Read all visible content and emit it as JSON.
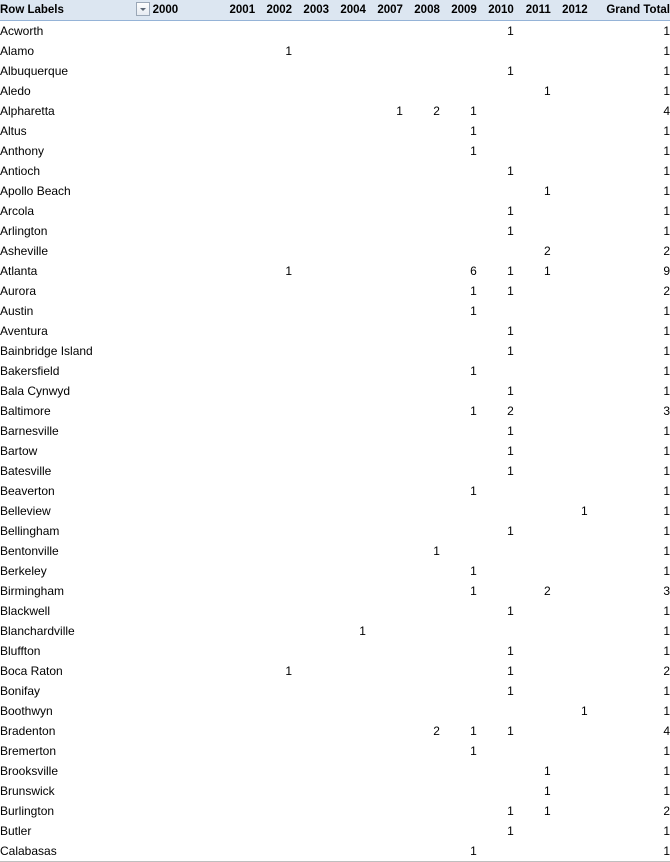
{
  "table": {
    "row_label_header": "Row Labels",
    "filter_icon": "chevron-down-icon",
    "grand_total_header": "Grand Total",
    "header_bg": "#dce6f1",
    "header_border": "#95b3d7",
    "year_columns": [
      "2000",
      "2001",
      "2002",
      "2003",
      "2004",
      "2007",
      "2008",
      "2009",
      "2010",
      "2011",
      "2012"
    ],
    "rows": [
      {
        "label": "Acworth",
        "values": [
          "",
          "",
          "",
          "",
          "",
          "",
          "",
          "",
          "1",
          "",
          ""
        ],
        "total": "1"
      },
      {
        "label": "Alamo",
        "values": [
          "",
          "",
          "1",
          "",
          "",
          "",
          "",
          "",
          "",
          "",
          ""
        ],
        "total": "1"
      },
      {
        "label": "Albuquerque",
        "values": [
          "",
          "",
          "",
          "",
          "",
          "",
          "",
          "",
          "1",
          "",
          ""
        ],
        "total": "1"
      },
      {
        "label": "Aledo",
        "values": [
          "",
          "",
          "",
          "",
          "",
          "",
          "",
          "",
          "",
          "1",
          ""
        ],
        "total": "1"
      },
      {
        "label": "Alpharetta",
        "values": [
          "",
          "",
          "",
          "",
          "",
          "1",
          "2",
          "1",
          "",
          "",
          ""
        ],
        "total": "4"
      },
      {
        "label": "Altus",
        "values": [
          "",
          "",
          "",
          "",
          "",
          "",
          "",
          "1",
          "",
          "",
          ""
        ],
        "total": "1"
      },
      {
        "label": "Anthony",
        "values": [
          "",
          "",
          "",
          "",
          "",
          "",
          "",
          "1",
          "",
          "",
          ""
        ],
        "total": "1"
      },
      {
        "label": "Antioch",
        "values": [
          "",
          "",
          "",
          "",
          "",
          "",
          "",
          "",
          "1",
          "",
          ""
        ],
        "total": "1"
      },
      {
        "label": "Apollo Beach",
        "values": [
          "",
          "",
          "",
          "",
          "",
          "",
          "",
          "",
          "",
          "1",
          ""
        ],
        "total": "1"
      },
      {
        "label": "Arcola",
        "values": [
          "",
          "",
          "",
          "",
          "",
          "",
          "",
          "",
          "1",
          "",
          ""
        ],
        "total": "1"
      },
      {
        "label": "Arlington",
        "values": [
          "",
          "",
          "",
          "",
          "",
          "",
          "",
          "",
          "1",
          "",
          ""
        ],
        "total": "1"
      },
      {
        "label": "Asheville",
        "values": [
          "",
          "",
          "",
          "",
          "",
          "",
          "",
          "",
          "",
          "2",
          ""
        ],
        "total": "2"
      },
      {
        "label": "Atlanta",
        "values": [
          "",
          "",
          "1",
          "",
          "",
          "",
          "",
          "6",
          "1",
          "1",
          ""
        ],
        "total": "9"
      },
      {
        "label": "Aurora",
        "values": [
          "",
          "",
          "",
          "",
          "",
          "",
          "",
          "1",
          "1",
          "",
          ""
        ],
        "total": "2"
      },
      {
        "label": "Austin",
        "values": [
          "",
          "",
          "",
          "",
          "",
          "",
          "",
          "1",
          "",
          "",
          ""
        ],
        "total": "1"
      },
      {
        "label": "Aventura",
        "values": [
          "",
          "",
          "",
          "",
          "",
          "",
          "",
          "",
          "1",
          "",
          ""
        ],
        "total": "1"
      },
      {
        "label": "Bainbridge Island",
        "values": [
          "",
          "",
          "",
          "",
          "",
          "",
          "",
          "",
          "1",
          "",
          ""
        ],
        "total": "1"
      },
      {
        "label": "Bakersfield",
        "values": [
          "",
          "",
          "",
          "",
          "",
          "",
          "",
          "1",
          "",
          "",
          ""
        ],
        "total": "1"
      },
      {
        "label": "Bala Cynwyd",
        "values": [
          "",
          "",
          "",
          "",
          "",
          "",
          "",
          "",
          "1",
          "",
          ""
        ],
        "total": "1"
      },
      {
        "label": "Baltimore",
        "values": [
          "",
          "",
          "",
          "",
          "",
          "",
          "",
          "1",
          "2",
          "",
          ""
        ],
        "total": "3"
      },
      {
        "label": "Barnesville",
        "values": [
          "",
          "",
          "",
          "",
          "",
          "",
          "",
          "",
          "1",
          "",
          ""
        ],
        "total": "1"
      },
      {
        "label": "Bartow",
        "values": [
          "",
          "",
          "",
          "",
          "",
          "",
          "",
          "",
          "1",
          "",
          ""
        ],
        "total": "1"
      },
      {
        "label": "Batesville",
        "values": [
          "",
          "",
          "",
          "",
          "",
          "",
          "",
          "",
          "1",
          "",
          ""
        ],
        "total": "1"
      },
      {
        "label": "Beaverton",
        "values": [
          "",
          "",
          "",
          "",
          "",
          "",
          "",
          "1",
          "",
          "",
          ""
        ],
        "total": "1"
      },
      {
        "label": "Belleview",
        "values": [
          "",
          "",
          "",
          "",
          "",
          "",
          "",
          "",
          "",
          "",
          "1"
        ],
        "total": "1"
      },
      {
        "label": "Bellingham",
        "values": [
          "",
          "",
          "",
          "",
          "",
          "",
          "",
          "",
          "1",
          "",
          ""
        ],
        "total": "1"
      },
      {
        "label": "Bentonville",
        "values": [
          "",
          "",
          "",
          "",
          "",
          "",
          "1",
          "",
          "",
          "",
          ""
        ],
        "total": "1"
      },
      {
        "label": "Berkeley",
        "values": [
          "",
          "",
          "",
          "",
          "",
          "",
          "",
          "1",
          "",
          "",
          ""
        ],
        "total": "1"
      },
      {
        "label": "Birmingham",
        "values": [
          "",
          "",
          "",
          "",
          "",
          "",
          "",
          "1",
          "",
          "2",
          ""
        ],
        "total": "3"
      },
      {
        "label": "Blackwell",
        "values": [
          "",
          "",
          "",
          "",
          "",
          "",
          "",
          "",
          "1",
          "",
          ""
        ],
        "total": "1"
      },
      {
        "label": "Blanchardville",
        "values": [
          "",
          "",
          "",
          "",
          "1",
          "",
          "",
          "",
          "",
          "",
          ""
        ],
        "total": "1"
      },
      {
        "label": "Bluffton",
        "values": [
          "",
          "",
          "",
          "",
          "",
          "",
          "",
          "",
          "1",
          "",
          ""
        ],
        "total": "1"
      },
      {
        "label": "Boca Raton",
        "values": [
          "",
          "",
          "1",
          "",
          "",
          "",
          "",
          "",
          "1",
          "",
          ""
        ],
        "total": "2"
      },
      {
        "label": "Bonifay",
        "values": [
          "",
          "",
          "",
          "",
          "",
          "",
          "",
          "",
          "1",
          "",
          ""
        ],
        "total": "1"
      },
      {
        "label": "Boothwyn",
        "values": [
          "",
          "",
          "",
          "",
          "",
          "",
          "",
          "",
          "",
          "",
          "1"
        ],
        "total": "1"
      },
      {
        "label": "Bradenton",
        "values": [
          "",
          "",
          "",
          "",
          "",
          "",
          "2",
          "1",
          "1",
          "",
          ""
        ],
        "total": "4"
      },
      {
        "label": "Bremerton",
        "values": [
          "",
          "",
          "",
          "",
          "",
          "",
          "",
          "1",
          "",
          "",
          ""
        ],
        "total": "1"
      },
      {
        "label": "Brooksville",
        "values": [
          "",
          "",
          "",
          "",
          "",
          "",
          "",
          "",
          "",
          "1",
          ""
        ],
        "total": "1"
      },
      {
        "label": "Brunswick",
        "values": [
          "",
          "",
          "",
          "",
          "",
          "",
          "",
          "",
          "",
          "1",
          ""
        ],
        "total": "1"
      },
      {
        "label": "Burlington",
        "values": [
          "",
          "",
          "",
          "",
          "",
          "",
          "",
          "",
          "1",
          "1",
          ""
        ],
        "total": "2"
      },
      {
        "label": "Butler",
        "values": [
          "",
          "",
          "",
          "",
          "",
          "",
          "",
          "",
          "1",
          "",
          ""
        ],
        "total": "1"
      },
      {
        "label": "Calabasas",
        "values": [
          "",
          "",
          "",
          "",
          "",
          "",
          "",
          "1",
          "",
          "",
          ""
        ],
        "total": "1"
      }
    ]
  }
}
